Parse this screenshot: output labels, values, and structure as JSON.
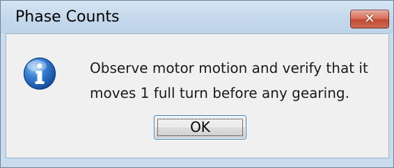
{
  "dialog": {
    "title": "Phase Counts",
    "close_glyph": "✕",
    "icon": "information-icon",
    "message_lines": [
      "Observe motor motion and verify that it",
      "moves 1 full turn before any gearing."
    ],
    "ok_label": "OK"
  },
  "colors": {
    "title_bar": "#c4d8ec",
    "close_button": "#c24a35",
    "client_bg": "#f0f0f0",
    "icon_blue": "#1f5fb8",
    "button_border": "#3c7fb1"
  }
}
